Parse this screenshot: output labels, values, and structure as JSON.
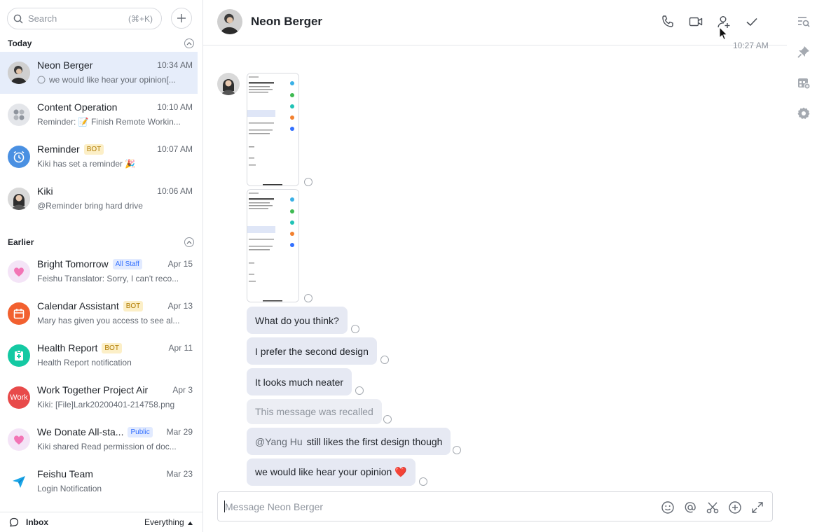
{
  "search": {
    "placeholder": "Search",
    "shortcut": "(⌘+K)"
  },
  "sections": {
    "today": "Today",
    "earlier": "Earlier"
  },
  "conversations": [
    {
      "name": "Neon Berger",
      "time": "10:34 AM",
      "preview": "we would like hear your opinion[...",
      "avatar": "person-photo",
      "active": true
    },
    {
      "name": "Content Operation",
      "time": "10:10 AM",
      "preview": "Reminder: 📝 Finish Remote Workin...",
      "avatar": "group-icon"
    },
    {
      "name": "Reminder",
      "tag": "BOT",
      "time": "10:07 AM",
      "preview": "Kiki has set a reminder 🎉",
      "avatar": "alarm-clock-icon"
    },
    {
      "name": "Kiki",
      "time": "10:06 AM",
      "preview": "@Reminder bring hard drive",
      "avatar": "person-photo"
    },
    {
      "name": "Bright Tomorrow",
      "tag": "All Staff",
      "time": "Apr 15",
      "preview": "Feishu Translator: Sorry, I can't reco...",
      "avatar": "heart-icon"
    },
    {
      "name": "Calendar Assistant",
      "tag": "BOT",
      "time": "Apr 13",
      "preview": "Mary has given you access to see al...",
      "avatar": "calendar-icon"
    },
    {
      "name": "Health Report",
      "tag": "BOT",
      "time": "Apr 11",
      "preview": "Health Report notification",
      "avatar": "health-icon"
    },
    {
      "name": "Work Together Project Air",
      "time": "Apr 3",
      "preview": "Kiki: [File]Lark20200401-214758.png",
      "avatar": "Work"
    },
    {
      "name": "We Donate All-sta...",
      "tag": "Public",
      "time": "Mar 29",
      "preview": "Kiki shared Read permission of doc...",
      "avatar": "heart-icon"
    },
    {
      "name": "Feishu Team",
      "time": "Mar 23",
      "preview": "Login Notification",
      "avatar": "paper-plane-icon"
    }
  ],
  "bottom": {
    "inbox": "Inbox",
    "filter": "Everything"
  },
  "chat": {
    "title": "Neon Berger",
    "timestamp": "10:27 AM",
    "messages": [
      {
        "text": "What do you think?"
      },
      {
        "text": "I prefer the second design"
      },
      {
        "text": "It looks much neater"
      },
      {
        "text": "This message was recalled",
        "recalled": true
      },
      {
        "mention": "@Yang Hu",
        "text": "still likes the first design though"
      },
      {
        "text": "we would like hear your opinion ❤️"
      }
    ],
    "composer_placeholder": "Message Neon Berger"
  },
  "colors": {
    "accent": "#3370ff",
    "active_row": "#e6edfa",
    "bubble": "#e6e9f3"
  }
}
